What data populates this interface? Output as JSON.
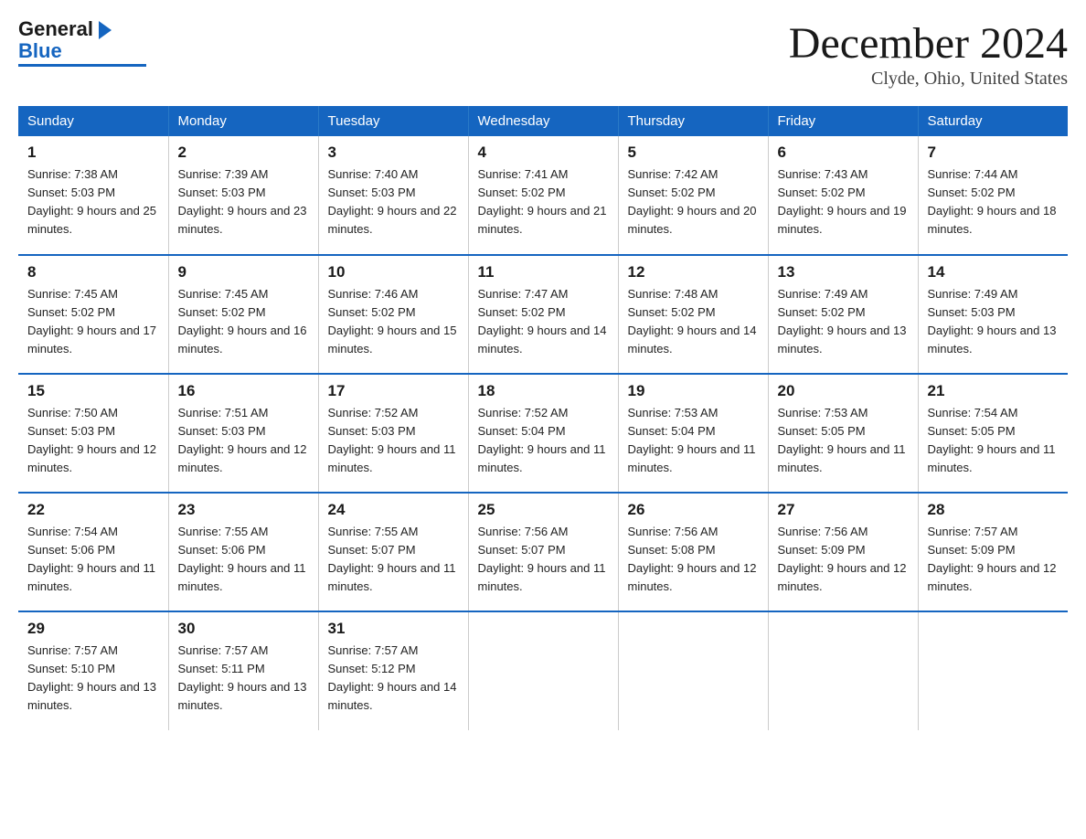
{
  "logo": {
    "line1": "General",
    "line2": "Blue"
  },
  "title": "December 2024",
  "location": "Clyde, Ohio, United States",
  "days_of_week": [
    "Sunday",
    "Monday",
    "Tuesday",
    "Wednesday",
    "Thursday",
    "Friday",
    "Saturday"
  ],
  "weeks": [
    [
      {
        "day": "1",
        "sunrise": "7:38 AM",
        "sunset": "5:03 PM",
        "daylight": "9 hours and 25 minutes."
      },
      {
        "day": "2",
        "sunrise": "7:39 AM",
        "sunset": "5:03 PM",
        "daylight": "9 hours and 23 minutes."
      },
      {
        "day": "3",
        "sunrise": "7:40 AM",
        "sunset": "5:03 PM",
        "daylight": "9 hours and 22 minutes."
      },
      {
        "day": "4",
        "sunrise": "7:41 AM",
        "sunset": "5:02 PM",
        "daylight": "9 hours and 21 minutes."
      },
      {
        "day": "5",
        "sunrise": "7:42 AM",
        "sunset": "5:02 PM",
        "daylight": "9 hours and 20 minutes."
      },
      {
        "day": "6",
        "sunrise": "7:43 AM",
        "sunset": "5:02 PM",
        "daylight": "9 hours and 19 minutes."
      },
      {
        "day": "7",
        "sunrise": "7:44 AM",
        "sunset": "5:02 PM",
        "daylight": "9 hours and 18 minutes."
      }
    ],
    [
      {
        "day": "8",
        "sunrise": "7:45 AM",
        "sunset": "5:02 PM",
        "daylight": "9 hours and 17 minutes."
      },
      {
        "day": "9",
        "sunrise": "7:45 AM",
        "sunset": "5:02 PM",
        "daylight": "9 hours and 16 minutes."
      },
      {
        "day": "10",
        "sunrise": "7:46 AM",
        "sunset": "5:02 PM",
        "daylight": "9 hours and 15 minutes."
      },
      {
        "day": "11",
        "sunrise": "7:47 AM",
        "sunset": "5:02 PM",
        "daylight": "9 hours and 14 minutes."
      },
      {
        "day": "12",
        "sunrise": "7:48 AM",
        "sunset": "5:02 PM",
        "daylight": "9 hours and 14 minutes."
      },
      {
        "day": "13",
        "sunrise": "7:49 AM",
        "sunset": "5:02 PM",
        "daylight": "9 hours and 13 minutes."
      },
      {
        "day": "14",
        "sunrise": "7:49 AM",
        "sunset": "5:03 PM",
        "daylight": "9 hours and 13 minutes."
      }
    ],
    [
      {
        "day": "15",
        "sunrise": "7:50 AM",
        "sunset": "5:03 PM",
        "daylight": "9 hours and 12 minutes."
      },
      {
        "day": "16",
        "sunrise": "7:51 AM",
        "sunset": "5:03 PM",
        "daylight": "9 hours and 12 minutes."
      },
      {
        "day": "17",
        "sunrise": "7:52 AM",
        "sunset": "5:03 PM",
        "daylight": "9 hours and 11 minutes."
      },
      {
        "day": "18",
        "sunrise": "7:52 AM",
        "sunset": "5:04 PM",
        "daylight": "9 hours and 11 minutes."
      },
      {
        "day": "19",
        "sunrise": "7:53 AM",
        "sunset": "5:04 PM",
        "daylight": "9 hours and 11 minutes."
      },
      {
        "day": "20",
        "sunrise": "7:53 AM",
        "sunset": "5:05 PM",
        "daylight": "9 hours and 11 minutes."
      },
      {
        "day": "21",
        "sunrise": "7:54 AM",
        "sunset": "5:05 PM",
        "daylight": "9 hours and 11 minutes."
      }
    ],
    [
      {
        "day": "22",
        "sunrise": "7:54 AM",
        "sunset": "5:06 PM",
        "daylight": "9 hours and 11 minutes."
      },
      {
        "day": "23",
        "sunrise": "7:55 AM",
        "sunset": "5:06 PM",
        "daylight": "9 hours and 11 minutes."
      },
      {
        "day": "24",
        "sunrise": "7:55 AM",
        "sunset": "5:07 PM",
        "daylight": "9 hours and 11 minutes."
      },
      {
        "day": "25",
        "sunrise": "7:56 AM",
        "sunset": "5:07 PM",
        "daylight": "9 hours and 11 minutes."
      },
      {
        "day": "26",
        "sunrise": "7:56 AM",
        "sunset": "5:08 PM",
        "daylight": "9 hours and 12 minutes."
      },
      {
        "day": "27",
        "sunrise": "7:56 AM",
        "sunset": "5:09 PM",
        "daylight": "9 hours and 12 minutes."
      },
      {
        "day": "28",
        "sunrise": "7:57 AM",
        "sunset": "5:09 PM",
        "daylight": "9 hours and 12 minutes."
      }
    ],
    [
      {
        "day": "29",
        "sunrise": "7:57 AM",
        "sunset": "5:10 PM",
        "daylight": "9 hours and 13 minutes."
      },
      {
        "day": "30",
        "sunrise": "7:57 AM",
        "sunset": "5:11 PM",
        "daylight": "9 hours and 13 minutes."
      },
      {
        "day": "31",
        "sunrise": "7:57 AM",
        "sunset": "5:12 PM",
        "daylight": "9 hours and 14 minutes."
      },
      null,
      null,
      null,
      null
    ]
  ]
}
